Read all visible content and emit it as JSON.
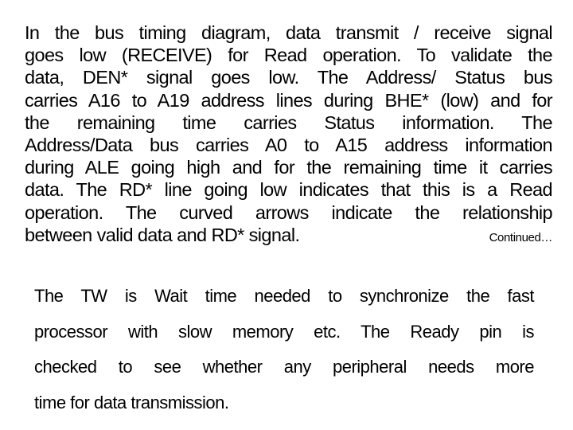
{
  "slide": {
    "paragraph1": {
      "lines": [
        "In the bus timing diagram, data transmit / receive signal",
        "goes low (RECEIVE) for Read operation. To validate the",
        "data, DEN* signal goes low. The Address/ Status bus",
        "carries A16 to A19 address lines during BHE* (low) and for",
        "the remaining time carries Status information. The",
        "Address/Data bus carries A0 to A15 address information",
        "during ALE going high and for the remaining time it carries",
        "data. The RD* line going low indicates that this is a Read",
        "operation. The curved arrows indicate the relationship",
        "between valid data and RD* signal."
      ],
      "continued_label": "Continued…"
    },
    "paragraph2": {
      "lines": [
        "The TW is Wait time needed to synchronize the fast",
        "processor with slow memory etc. The Ready pin is",
        "checked to see whether any peripheral needs more",
        "time for data transmission."
      ]
    }
  }
}
